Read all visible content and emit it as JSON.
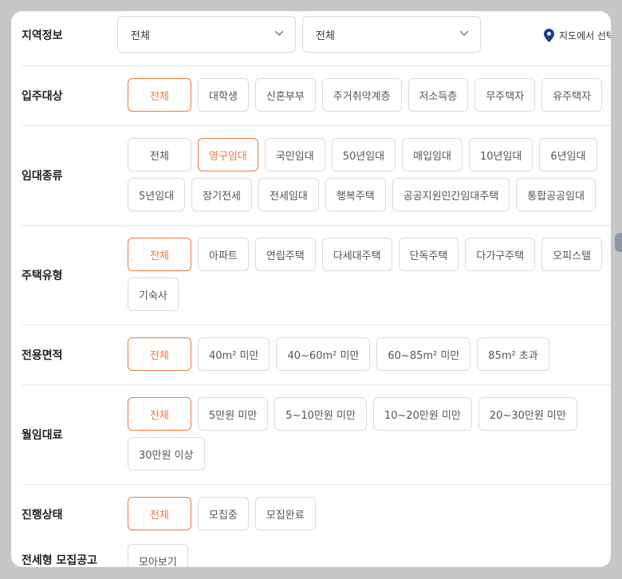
{
  "region": {
    "label": "지역정보",
    "select1": "전체",
    "select2": "전체",
    "map_link": "지도에서 선택하"
  },
  "rows": [
    {
      "key": "target",
      "label": "입주대상",
      "lines": [
        [
          "전체",
          "대학생",
          "신혼부부",
          "주거취약계층",
          "저소득층",
          "무주택자",
          "유주택자"
        ]
      ],
      "selected": "전체"
    },
    {
      "key": "rent-type",
      "label": "임대종류",
      "lines": [
        [
          "전체",
          "영구임대",
          "국민임대",
          "50년임대",
          "매입임대",
          "10년임대",
          "6년임대"
        ],
        [
          "5년임대",
          "장기전세",
          "전세임대",
          "행복주택",
          "공공지원민간임대주택",
          "통합공공임대"
        ]
      ],
      "selected": "영구임대"
    },
    {
      "key": "house-type",
      "label": "주택유형",
      "lines": [
        [
          "전체",
          "아파트",
          "연립주택",
          "다세대주택",
          "단독주택",
          "다가구주택",
          "오피스텔"
        ],
        [
          "기숙사"
        ]
      ],
      "selected": "전체"
    },
    {
      "key": "area",
      "label": "전용면적",
      "lines": [
        [
          "전체",
          "40m² 미만",
          "40~60m² 미만",
          "60~85m² 미만",
          "85m² 초과"
        ]
      ],
      "selected": "전체"
    },
    {
      "key": "monthly-rent",
      "label": "월임대료",
      "lines": [
        [
          "전체",
          "5만원 미만",
          "5~10만원 미만",
          "10~20만원 미만",
          "20~30만원 미만"
        ],
        [
          "30만원 이상"
        ]
      ],
      "selected": "전체"
    },
    {
      "key": "status",
      "label": "진행상태",
      "lines": [
        [
          "전체",
          "모집중",
          "모집완료"
        ]
      ],
      "selected": "전체"
    },
    {
      "key": "jeonse",
      "label": "전세형 모집공고",
      "lines": [
        [
          "모아보기"
        ]
      ],
      "selected": ""
    }
  ],
  "colors": {
    "accent": "#f07a3d",
    "pin": "#1a3c8f"
  }
}
